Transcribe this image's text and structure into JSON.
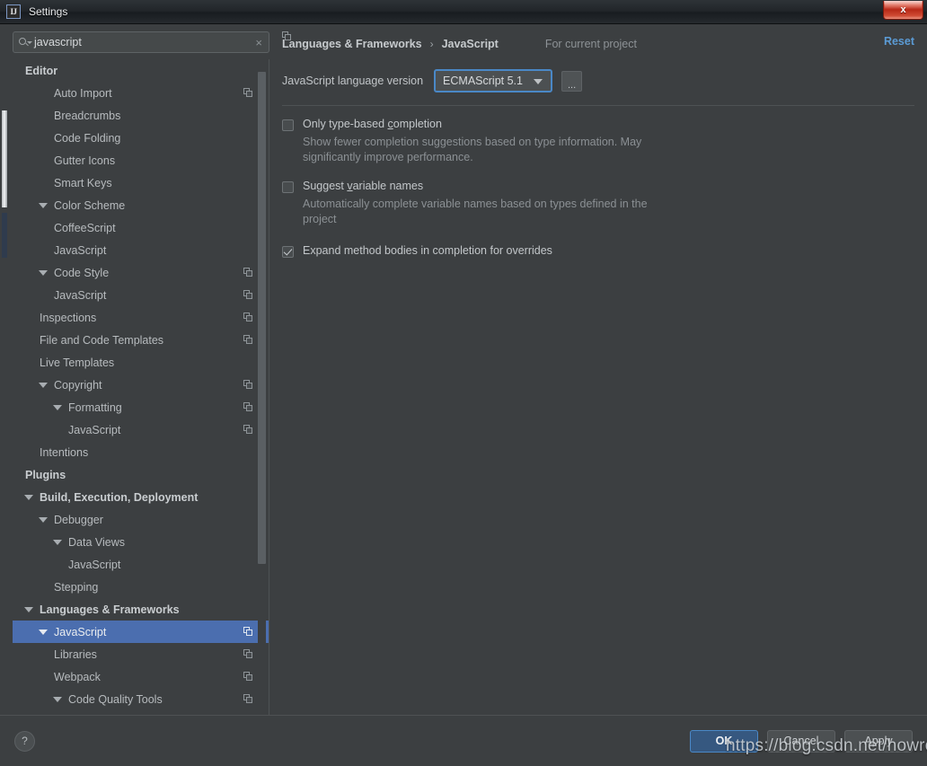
{
  "window": {
    "title": "Settings",
    "app_icon": "IJ",
    "close_label": "x"
  },
  "sidebar": {
    "search": {
      "value": "javascript",
      "clear_label": "×"
    },
    "tree": [
      {
        "label": "Editor",
        "indent": 0,
        "bold": true,
        "arrow": false,
        "copy": false,
        "selected": false
      },
      {
        "label": "Auto Import",
        "indent": 2,
        "bold": false,
        "arrow": false,
        "copy": true,
        "selected": false
      },
      {
        "label": "Breadcrumbs",
        "indent": 2,
        "bold": false,
        "arrow": false,
        "copy": false,
        "selected": false
      },
      {
        "label": "Code Folding",
        "indent": 2,
        "bold": false,
        "arrow": false,
        "copy": false,
        "selected": false
      },
      {
        "label": "Gutter Icons",
        "indent": 2,
        "bold": false,
        "arrow": false,
        "copy": false,
        "selected": false
      },
      {
        "label": "Smart Keys",
        "indent": 2,
        "bold": false,
        "arrow": false,
        "copy": false,
        "selected": false
      },
      {
        "label": "Color Scheme",
        "indent": 1,
        "bold": false,
        "arrow": true,
        "copy": false,
        "selected": false
      },
      {
        "label": "CoffeeScript",
        "indent": 2,
        "bold": false,
        "arrow": false,
        "copy": false,
        "selected": false
      },
      {
        "label": "JavaScript",
        "indent": 2,
        "bold": false,
        "arrow": false,
        "copy": false,
        "selected": false
      },
      {
        "label": "Code Style",
        "indent": 1,
        "bold": false,
        "arrow": true,
        "copy": true,
        "selected": false
      },
      {
        "label": "JavaScript",
        "indent": 2,
        "bold": false,
        "arrow": false,
        "copy": true,
        "selected": false
      },
      {
        "label": "Inspections",
        "indent": 1,
        "bold": false,
        "arrow": false,
        "copy": true,
        "selected": false
      },
      {
        "label": "File and Code Templates",
        "indent": 1,
        "bold": false,
        "arrow": false,
        "copy": true,
        "selected": false
      },
      {
        "label": "Live Templates",
        "indent": 1,
        "bold": false,
        "arrow": false,
        "copy": false,
        "selected": false
      },
      {
        "label": "Copyright",
        "indent": 1,
        "bold": false,
        "arrow": true,
        "copy": true,
        "selected": false
      },
      {
        "label": "Formatting",
        "indent": 2,
        "bold": false,
        "arrow": true,
        "copy": true,
        "selected": false
      },
      {
        "label": "JavaScript",
        "indent": 3,
        "bold": false,
        "arrow": false,
        "copy": true,
        "selected": false
      },
      {
        "label": "Intentions",
        "indent": 1,
        "bold": false,
        "arrow": false,
        "copy": false,
        "selected": false
      },
      {
        "label": "Plugins",
        "indent": 0,
        "bold": true,
        "arrow": false,
        "copy": false,
        "selected": false
      },
      {
        "label": "Build, Execution, Deployment",
        "indent": 0,
        "bold": true,
        "arrow": true,
        "copy": false,
        "selected": false
      },
      {
        "label": "Debugger",
        "indent": 1,
        "bold": false,
        "arrow": true,
        "copy": false,
        "selected": false
      },
      {
        "label": "Data Views",
        "indent": 2,
        "bold": false,
        "arrow": true,
        "copy": false,
        "selected": false
      },
      {
        "label": "JavaScript",
        "indent": 3,
        "bold": false,
        "arrow": false,
        "copy": false,
        "selected": false
      },
      {
        "label": "Stepping",
        "indent": 2,
        "bold": false,
        "arrow": false,
        "copy": false,
        "selected": false
      },
      {
        "label": "Languages & Frameworks",
        "indent": 0,
        "bold": true,
        "arrow": true,
        "copy": false,
        "selected": false
      },
      {
        "label": "JavaScript",
        "indent": 1,
        "bold": false,
        "arrow": true,
        "copy": true,
        "selected": true
      },
      {
        "label": "Libraries",
        "indent": 2,
        "bold": false,
        "arrow": false,
        "copy": true,
        "selected": false
      },
      {
        "label": "Webpack",
        "indent": 2,
        "bold": false,
        "arrow": false,
        "copy": true,
        "selected": false
      },
      {
        "label": "Code Quality Tools",
        "indent": 2,
        "bold": false,
        "arrow": true,
        "copy": true,
        "selected": false
      }
    ]
  },
  "content": {
    "breadcrumb": {
      "parent": "Languages & Frameworks",
      "separator": "›",
      "current": "JavaScript"
    },
    "scope_label": "For current project",
    "reset_label": "Reset",
    "language_version": {
      "label": "JavaScript language version",
      "value": "ECMAScript 5.1",
      "more_label": "..."
    },
    "options": [
      {
        "title_pre": "Only type-based ",
        "title_mnemonic": "c",
        "title_post": "ompletion",
        "description": "Show fewer completion suggestions based on type information. May significantly improve performance.",
        "checked": false
      },
      {
        "title_pre": "Suggest ",
        "title_mnemonic": "v",
        "title_post": "ariable names",
        "description": "Automatically complete variable names based on types defined in the project",
        "checked": false
      },
      {
        "title_pre": "Expand method bodies in completion for overrides",
        "title_mnemonic": "",
        "title_post": "",
        "description": "",
        "checked": true
      }
    ]
  },
  "footer": {
    "help_label": "?",
    "ok_label": "OK",
    "cancel_label": "Cancel",
    "apply_label": "Apply"
  },
  "watermark": "https://blog.csdn.net/howroad",
  "colors": {
    "accent_blue": "#4b6eaf",
    "link_blue": "#5b9bd5",
    "primary_button": "#365880",
    "background": "#3c3f41",
    "close_red": "#b92a19"
  }
}
